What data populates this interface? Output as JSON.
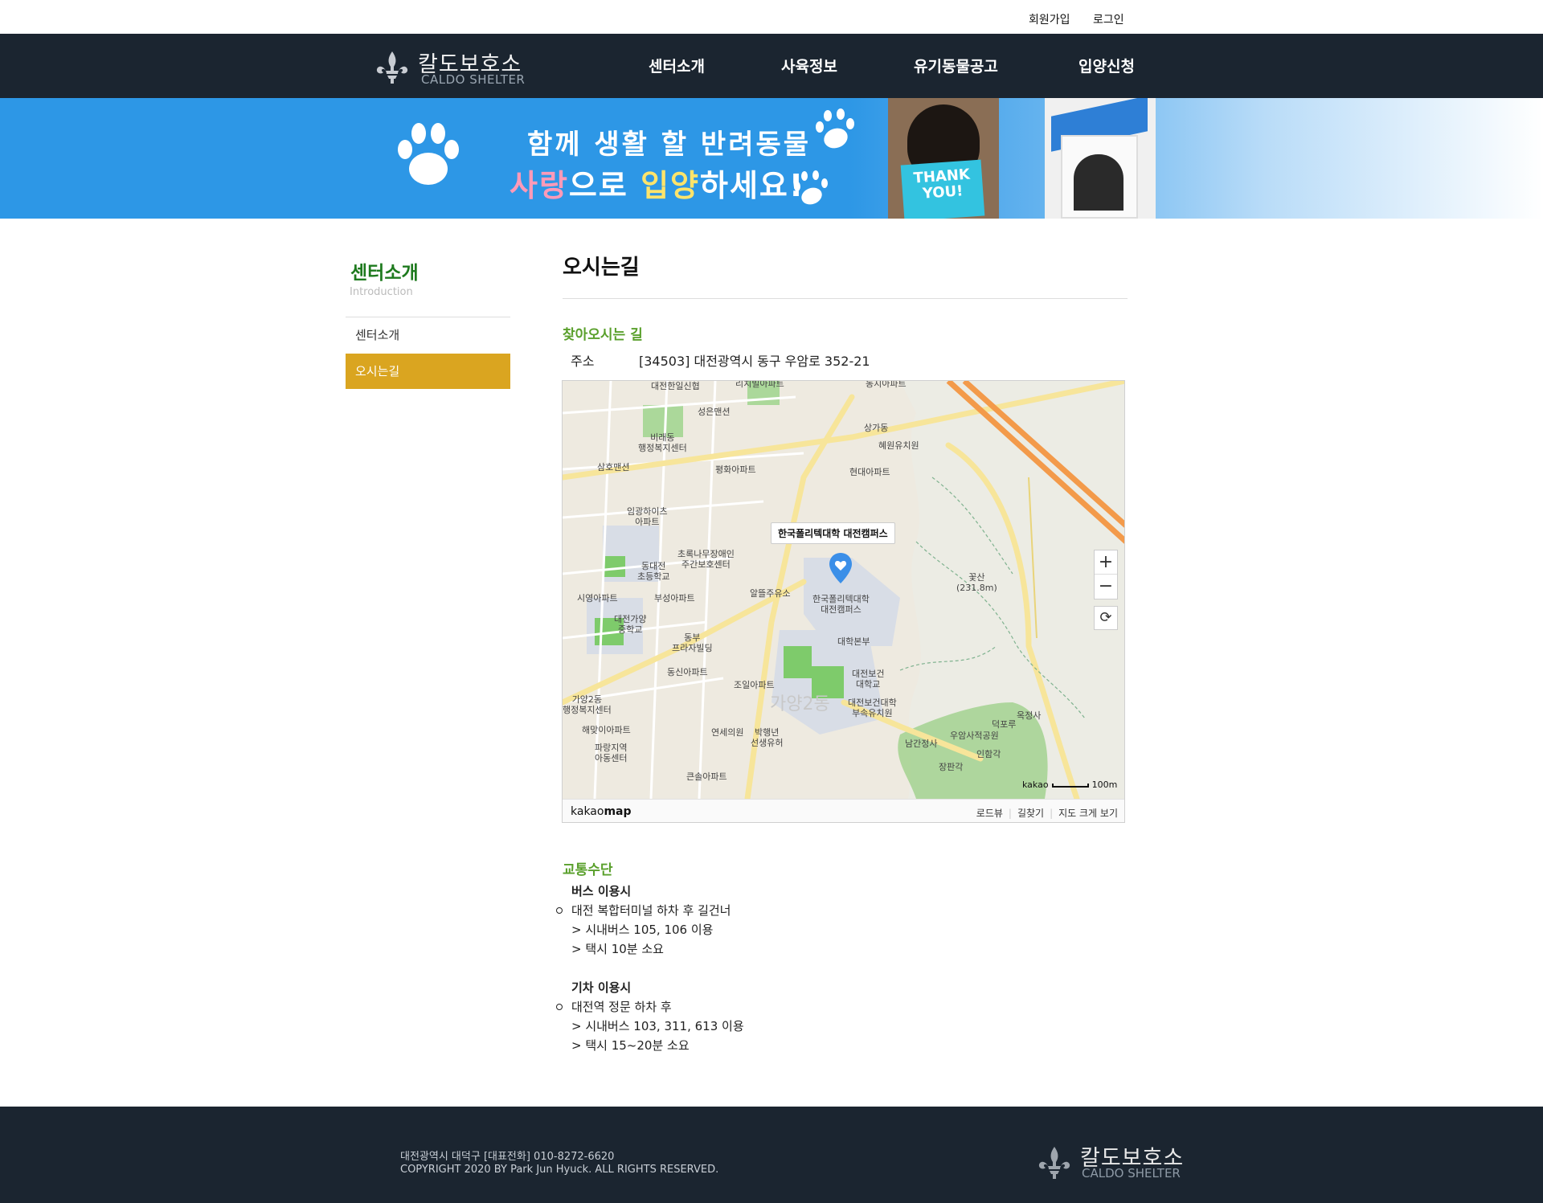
{
  "util": {
    "signup": "회원가입",
    "login": "로그인"
  },
  "logo": {
    "name_ko": "칼도보호소",
    "name_en": "CALDO SHELTER"
  },
  "nav": [
    "센터소개",
    "사육정보",
    "유기동물공고",
    "입양신청"
  ],
  "banner": {
    "line1": "함께 생활 할 반려동물",
    "line2_a": "사랑",
    "line2_b": "으로 ",
    "line2_c": "입양",
    "line2_d": "하세요!",
    "sign_text": "THANK YOU!"
  },
  "sidebar": {
    "title": "센터소개",
    "subtitle": "Introduction",
    "items": [
      {
        "label": "센터소개",
        "active": false
      },
      {
        "label": "오시는길",
        "active": true
      }
    ]
  },
  "content": {
    "page_title": "오시는길",
    "directions_title": "찾아오시는 길",
    "address_label": "주소",
    "address_value": "[34503] 대전광역시 동구 우암로 352-21",
    "transport_title": "교통수단"
  },
  "map": {
    "tooltip": "한국폴리텍대학 대전캠퍼스",
    "labels": [
      "대전한일신협",
      "리치빌아파트",
      "동지아파트",
      "성은맨션",
      "비래동\n행정복지센터",
      "상가동",
      "혜원유치원",
      "삼호맨션",
      "평화아파트",
      "현대아파트",
      "임광하이츠\n아파트",
      "초록나무장애인\n주간보호센터",
      "동대전\n초등학교",
      "알뜰주유소",
      "한국폴리텍대학\n대전캠퍼스",
      "꽃산\n(231.8m)",
      "시영아파트",
      "부성아파트",
      "대전가양\n중학교",
      "동부\n프라자빌딩",
      "대학본부",
      "동신아파트",
      "조일아파트",
      "대전보건\n대학교",
      "가양2동\n행정복지센터",
      "대전보건대학\n부속유치원",
      "옥정사",
      "해맞이아파트",
      "연세의원",
      "박행년\n선생유허",
      "우암사적공원",
      "덕포루",
      "남간정사",
      "인함각",
      "파랑지역\n아동센터",
      "장판각",
      "큰솔아파트",
      "가양2동"
    ],
    "scale_brand": "kakao",
    "scale_value": "100m",
    "zoom_in": "+",
    "zoom_out": "−",
    "refresh": "⟳",
    "brand_a": "kakao",
    "brand_b": "map",
    "links": [
      "로드뷰",
      "길찾기",
      "지도 크게 보기"
    ]
  },
  "transport": {
    "bus_head": "버스 이용시",
    "bus_main": "대전 복합터미널 하차 후 길건너",
    "bus_lines": [
      "> 시내버스 105, 106 이용",
      "> 택시 10분 소요"
    ],
    "train_head": "기차 이용시",
    "train_main": "대전역 정문 하차 후",
    "train_lines": [
      "> 시내버스 103, 311, 613 이용",
      "> 택시 15~20분 소요"
    ]
  },
  "footer": {
    "line1": "대전광역시 대덕구 [대표전화] 010-8272-6620",
    "line2": "COPYRIGHT 2020 BY Park Jun Hyuck. ALL RIGHTS RESERVED.",
    "logo_ko": "칼도보호소",
    "logo_en": "CALDO SHELTER"
  },
  "colors": {
    "header_bg": "#1b2530",
    "banner_blue": "#2d97e6",
    "sidebar_active": "#daa520",
    "sidebar_title": "#1e7a1e",
    "section_title": "#5aa02c",
    "marker": "#3b8fe8"
  }
}
